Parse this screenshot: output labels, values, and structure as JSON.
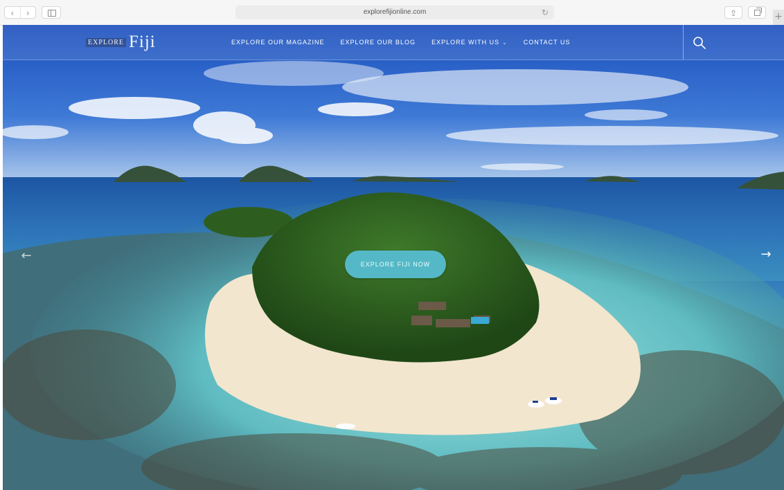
{
  "browser": {
    "url": "explorefijionline.com",
    "back_glyph": "‹",
    "forward_glyph": "›",
    "reload_glyph": "↻",
    "share_glyph": "⇪",
    "new_tab_glyph": "+"
  },
  "site": {
    "logo_small": "EXPLORE",
    "logo_big": "Fiji",
    "nav": [
      {
        "label": "EXPLORE OUR MAGAZINE"
      },
      {
        "label": "EXPLORE OUR BLOG"
      },
      {
        "label": "EXPLORE WITH US",
        "caret": "⌄"
      },
      {
        "label": "CONTACT US"
      }
    ],
    "search_icon": "search-icon"
  },
  "hero": {
    "cta_label": "EXPLORE FIJI NOW",
    "next_glyph": "→",
    "prev_glyph": "←",
    "colors": {
      "sky": "#2b63c9",
      "ocean": "#2a6bb8",
      "lagoon": "#7fd3d4",
      "sand": "#f2e6cf",
      "forest": "#2c5d1f",
      "cta": "#55b8c7"
    }
  }
}
